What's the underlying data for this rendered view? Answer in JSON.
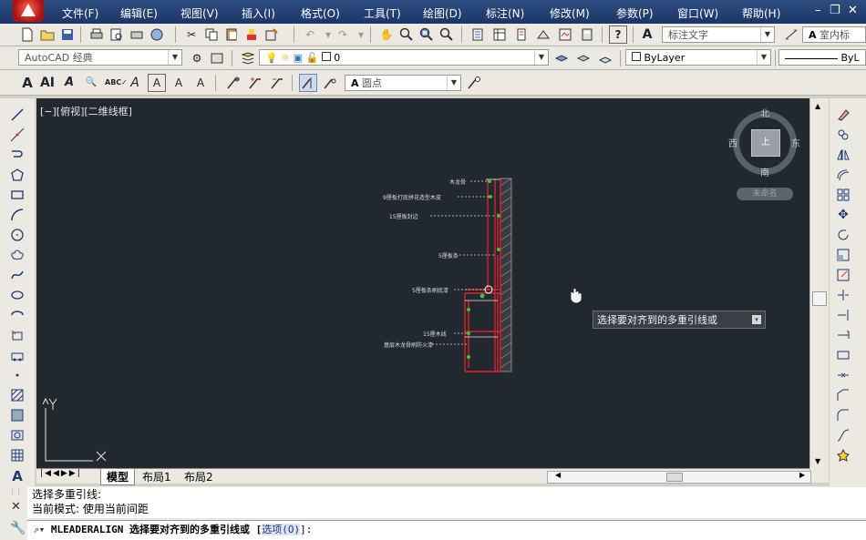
{
  "menu": [
    "文件(F)",
    "编辑(E)",
    "视图(V)",
    "插入(I)",
    "格式(O)",
    "工具(T)",
    "绘图(D)",
    "标注(N)",
    "修改(M)",
    "参数(P)",
    "窗口(W)",
    "帮助(H)"
  ],
  "toolbar": {
    "text_style": "标注文字",
    "indoor_label": "室内标",
    "workspace": "AutoCAD 经典",
    "layer_value": "0",
    "color_value": "ByLayer",
    "linetype_value": "ByL",
    "dot_style": "圆点"
  },
  "viewport": {
    "label": "[−][俯视][二维线框]"
  },
  "viewcube": {
    "north": "北",
    "south": "南",
    "east": "东",
    "west": "西",
    "top": "上",
    "wcs": "未命名"
  },
  "drawing": {
    "annotations": [
      "木龙骨",
      "9厘板打底拼花造型木皮",
      "15厘板封边",
      "5厘板条",
      "5厘板条刷底漆",
      "15厘木线",
      "基层木龙骨刷防火漆"
    ]
  },
  "tooltip": {
    "text": "选择要对齐到的多重引线或"
  },
  "tabs": {
    "model": "模型",
    "layout1": "布局1",
    "layout2": "布局2"
  },
  "command": {
    "history_1": "选择多重引线:",
    "history_2": "当前模式: 使用当前间距",
    "prompt_cmd": "MLEADERALIGN 选择要对齐到的多重引线或 [",
    "option": "选项(O)",
    "prompt_end": "]:"
  },
  "colors": {
    "canvas": "#212830",
    "menubar": "#1b3566",
    "red_line": "#e0202a",
    "green_grip": "#2ecc40"
  }
}
